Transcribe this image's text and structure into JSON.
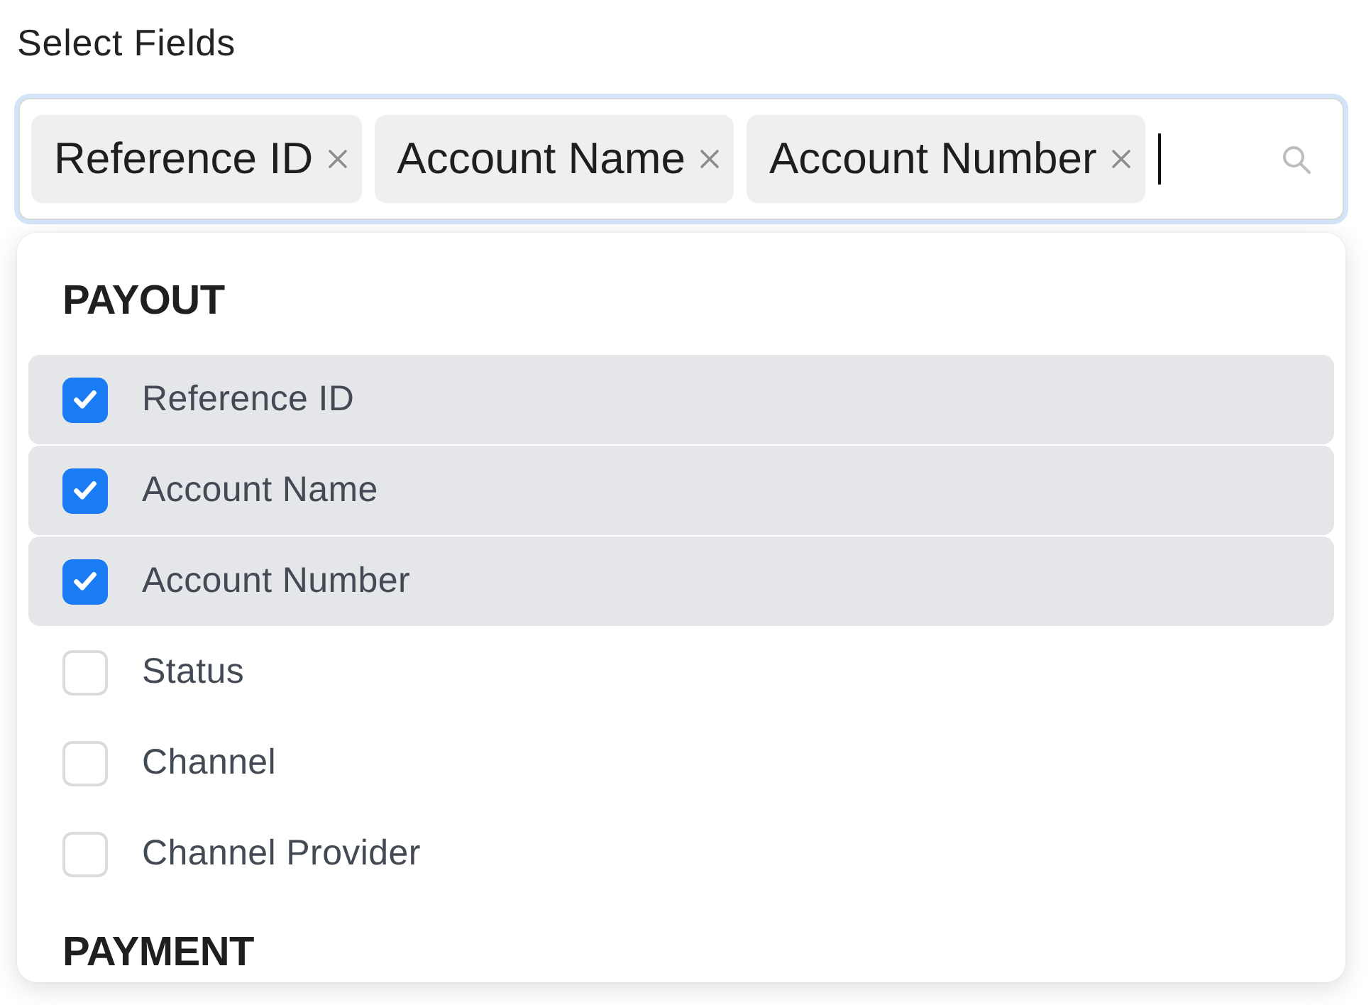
{
  "label": "Select Fields",
  "field": {
    "focused": true,
    "tags": [
      {
        "label": "Reference ID"
      },
      {
        "label": "Account Name"
      },
      {
        "label": "Account Number"
      }
    ]
  },
  "dropdown": {
    "sections": [
      {
        "heading": "PAYOUT",
        "items": [
          {
            "label": "Reference ID",
            "checked": true
          },
          {
            "label": "Account Name",
            "checked": true
          },
          {
            "label": "Account Number",
            "checked": true
          },
          {
            "label": "Status",
            "checked": false
          },
          {
            "label": "Channel",
            "checked": false
          },
          {
            "label": "Channel Provider",
            "checked": false
          }
        ]
      },
      {
        "heading": "PAYMENT"
      }
    ]
  }
}
